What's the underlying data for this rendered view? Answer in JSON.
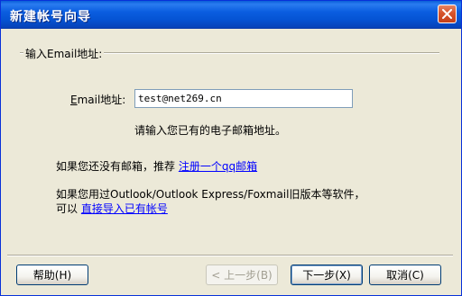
{
  "window": {
    "title": "新建帐号向导"
  },
  "section": {
    "label": "输入Email地址:"
  },
  "email": {
    "label_prefix": "E",
    "label_rest": "mail地址:",
    "value": "test@net269.cn"
  },
  "hint": "请输入您已有的电子邮箱地址。",
  "no_mailbox": {
    "text": "如果您还没有邮箱，推荐 ",
    "link": "注册一个qq邮箱"
  },
  "import": {
    "line1": "如果您用过Outlook/Outlook Express/Foxmail旧版本等软件，",
    "line2_text": "可以 ",
    "link": "直接导入已有帐号"
  },
  "buttons": {
    "help": "帮助(H)",
    "back": "< 上一步(B)",
    "next": "下一步(X)",
    "cancel": "取消(C)"
  }
}
